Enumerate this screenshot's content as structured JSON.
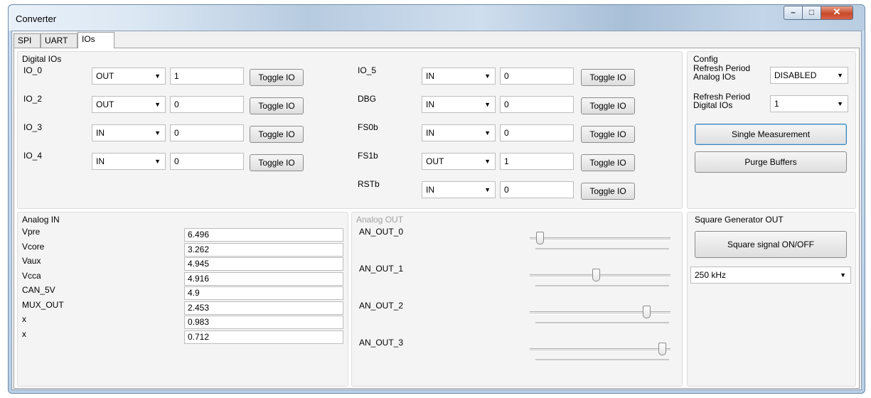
{
  "window": {
    "title": "Converter"
  },
  "tabs": [
    {
      "label": "SPI"
    },
    {
      "label": "UART"
    },
    {
      "label": "IOs"
    }
  ],
  "digital": {
    "title": "Digital IOs",
    "rows": [
      {
        "label": "IO_0",
        "dir": "OUT",
        "value": "1",
        "button": "Toggle IO"
      },
      {
        "label": "IO_2",
        "dir": "OUT",
        "value": "0",
        "button": "Toggle IO"
      },
      {
        "label": "IO_3",
        "dir": "IN",
        "value": "0",
        "button": "Toggle IO"
      },
      {
        "label": "IO_4",
        "dir": "IN",
        "value": "0",
        "button": "Toggle IO"
      },
      {
        "label": "IO_5",
        "dir": "IN",
        "value": "0",
        "button": "Toggle IO"
      },
      {
        "label": "DBG",
        "dir": "IN",
        "value": "0",
        "button": "Toggle IO"
      },
      {
        "label": "FS0b",
        "dir": "IN",
        "value": "0",
        "button": "Toggle IO"
      },
      {
        "label": "FS1b",
        "dir": "OUT",
        "value": "1",
        "button": "Toggle IO"
      },
      {
        "label": "RSTb",
        "dir": "IN",
        "value": "0",
        "button": "Toggle IO"
      }
    ]
  },
  "config": {
    "title": "Config",
    "refresh_analog_label": "Refresh Period Analog IOs",
    "refresh_analog_value": "DISABLED",
    "refresh_digital_label": "Refresh Period Digital IOs",
    "refresh_digital_value": "1",
    "single_measurement": "Single Measurement",
    "purge_buffers": "Purge Buffers"
  },
  "analog_in": {
    "title": "Analog IN",
    "rows": [
      {
        "label": "Vpre",
        "value": "6.496"
      },
      {
        "label": "Vcore",
        "value": "3.262"
      },
      {
        "label": "Vaux",
        "value": "4.945"
      },
      {
        "label": "Vcca",
        "value": "4.916"
      },
      {
        "label": "CAN_5V",
        "value": "4.9"
      },
      {
        "label": "MUX_OUT",
        "value": "2.453"
      },
      {
        "label": "x",
        "value": "0.983"
      },
      {
        "label": "x",
        "value": "0.712"
      }
    ]
  },
  "analog_out": {
    "title": "Analog OUT",
    "sliders": [
      {
        "label": "AN_OUT_0",
        "level": 0.05
      },
      {
        "label": "AN_OUT_1",
        "level": 0.47
      },
      {
        "label": "AN_OUT_2",
        "level": 0.85
      },
      {
        "label": "AN_OUT_3",
        "level": 0.97
      }
    ]
  },
  "square": {
    "title": "Square Generator OUT",
    "button": "Square signal ON/OFF",
    "frequency": "250 kHz"
  },
  "colors": {
    "window_frame": "#b9cfe6",
    "close_button": "#c74a2a",
    "focus_border": "#3c7fb1"
  }
}
